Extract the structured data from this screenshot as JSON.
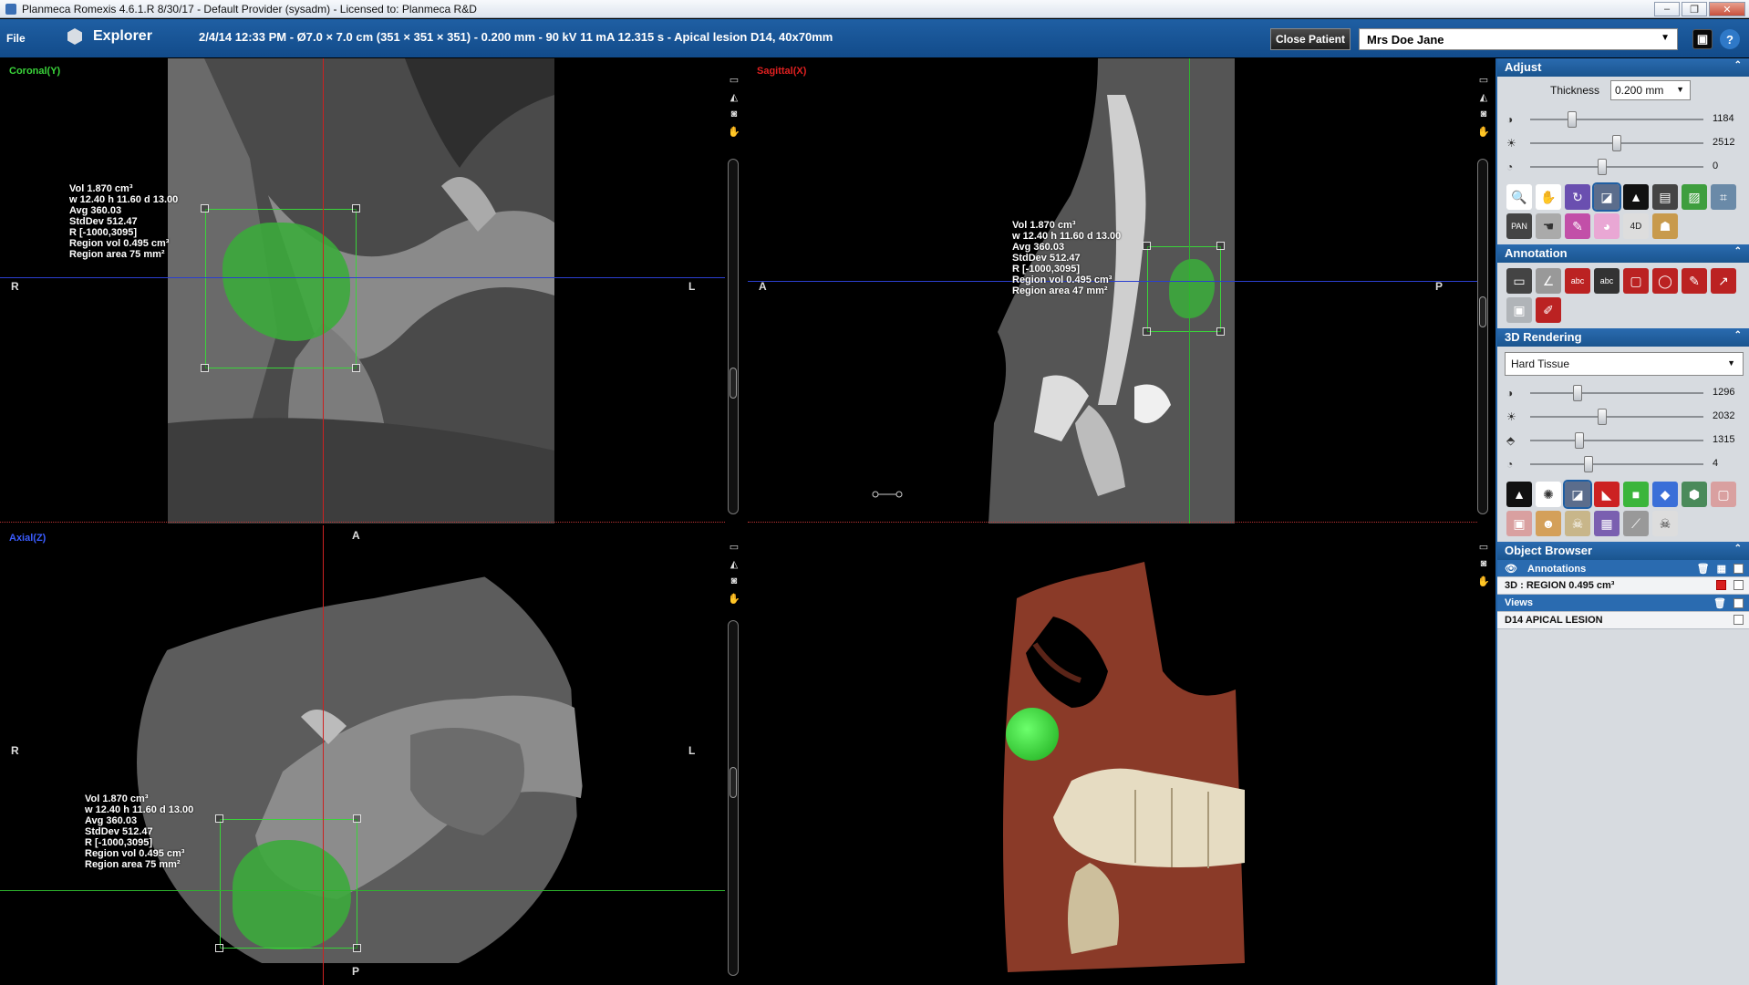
{
  "window": {
    "title": "Planmeca Romexis 4.6.1.R  8/30/17 - Default Provider (sysadm) - Licensed to: Planmeca R&D"
  },
  "topbar": {
    "file_label": "File",
    "explorer_label": "Explorer",
    "scan_info": "2/4/14 12:33 PM - Ø7.0 × 7.0 cm (351 × 351 × 351) - 0.200 mm - 90 kV 11 mA 12.315 s - Apical lesion D14, 40x70mm",
    "close_patient_label": "Close Patient",
    "patient_name": "Mrs Doe Jane"
  },
  "viewports": {
    "coronal": {
      "label": "Coronal(Y)",
      "left": "R",
      "right": "L",
      "annotation": [
        "Vol 1.870 cm³",
        "w 12.40 h 11.60 d 13.00",
        "Avg 360.03",
        "StdDev 512.47",
        "R [-1000,3095]",
        "Region vol 0.495 cm³",
        "Region area 75 mm²"
      ]
    },
    "sagittal": {
      "label": "Sagittal(X)",
      "left": "A",
      "right": "P",
      "annotation": [
        "Vol 1.870 cm³",
        "w 12.40 h 11.60 d 13.00",
        "Avg 360.03",
        "StdDev 512.47",
        "R [-1000,3095]",
        "Region vol 0.495 cm³",
        "Region area 47 mm²"
      ]
    },
    "axial": {
      "label": "Axial(Z)",
      "top": "A",
      "bottom": "P",
      "left": "R",
      "right": "L",
      "annotation": [
        "Vol 1.870 cm³",
        "w 12.40 h 11.60 d 13.00",
        "Avg 360.03",
        "StdDev 512.47",
        "R [-1000,3095]",
        "Region vol 0.495 cm³",
        "Region area 75 mm²"
      ]
    }
  },
  "panel": {
    "adjust": {
      "title": "Adjust",
      "thickness_label": "Thickness",
      "thickness_value": "0.200 mm",
      "sliders": [
        {
          "icon": "contrast-icon",
          "value": "1184",
          "fraction": 0.23
        },
        {
          "icon": "brightness-icon",
          "value": "2512",
          "fraction": 0.5
        },
        {
          "icon": "gamma-icon",
          "value": "0",
          "fraction": 0.41
        }
      ]
    },
    "annotation": {
      "title": "Annotation"
    },
    "rendering": {
      "title": "3D Rendering",
      "preset": "Hard Tissue",
      "sliders": [
        {
          "icon": "contrast-icon",
          "value": "1296",
          "fraction": 0.26
        },
        {
          "icon": "brightness-icon",
          "value": "2032",
          "fraction": 0.41
        },
        {
          "icon": "opacity-icon",
          "value": "1315",
          "fraction": 0.27
        },
        {
          "icon": "gamma-icon",
          "value": "4",
          "fraction": 0.33
        }
      ]
    },
    "object_browser": {
      "title": "Object Browser",
      "annotations_label": "Annotations",
      "region_label": "3D : REGION 0.495 cm³",
      "views_label": "Views",
      "view_item": "D14 APICAL LESION"
    }
  },
  "colors": {
    "accent": "#1f5fa3",
    "coronal_label": "#3ad43a",
    "sagittal_label": "#e02020",
    "axial_label": "#3a5cff"
  }
}
